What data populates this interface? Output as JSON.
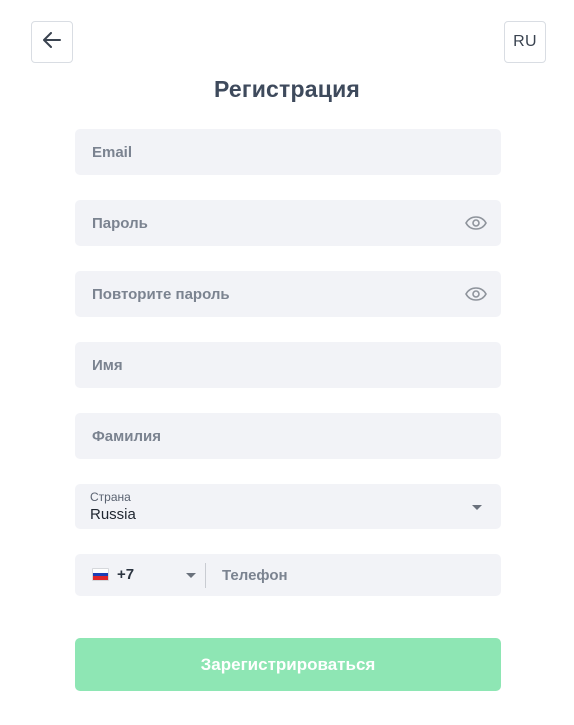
{
  "header": {
    "language": "RU",
    "title": "Регистрация"
  },
  "form": {
    "email": {
      "placeholder": "Email",
      "value": ""
    },
    "password": {
      "placeholder": "Пароль",
      "value": ""
    },
    "password_repeat": {
      "placeholder": "Повторите пароль",
      "value": ""
    },
    "first_name": {
      "placeholder": "Имя",
      "value": ""
    },
    "last_name": {
      "placeholder": "Фамилия",
      "value": ""
    },
    "country": {
      "label": "Страна",
      "value": "Russia"
    },
    "phone": {
      "dial_code": "+7",
      "placeholder": "Телефон",
      "value": ""
    },
    "submit_label": "Зарегистрироваться"
  },
  "colors": {
    "submit_bg": "#8ee6b4",
    "field_bg": "#f2f3f7",
    "title": "#3e4a5c"
  },
  "icons": [
    "arrow-left-icon",
    "eye-icon",
    "chevron-down-icon",
    "russia-flag-icon"
  ]
}
